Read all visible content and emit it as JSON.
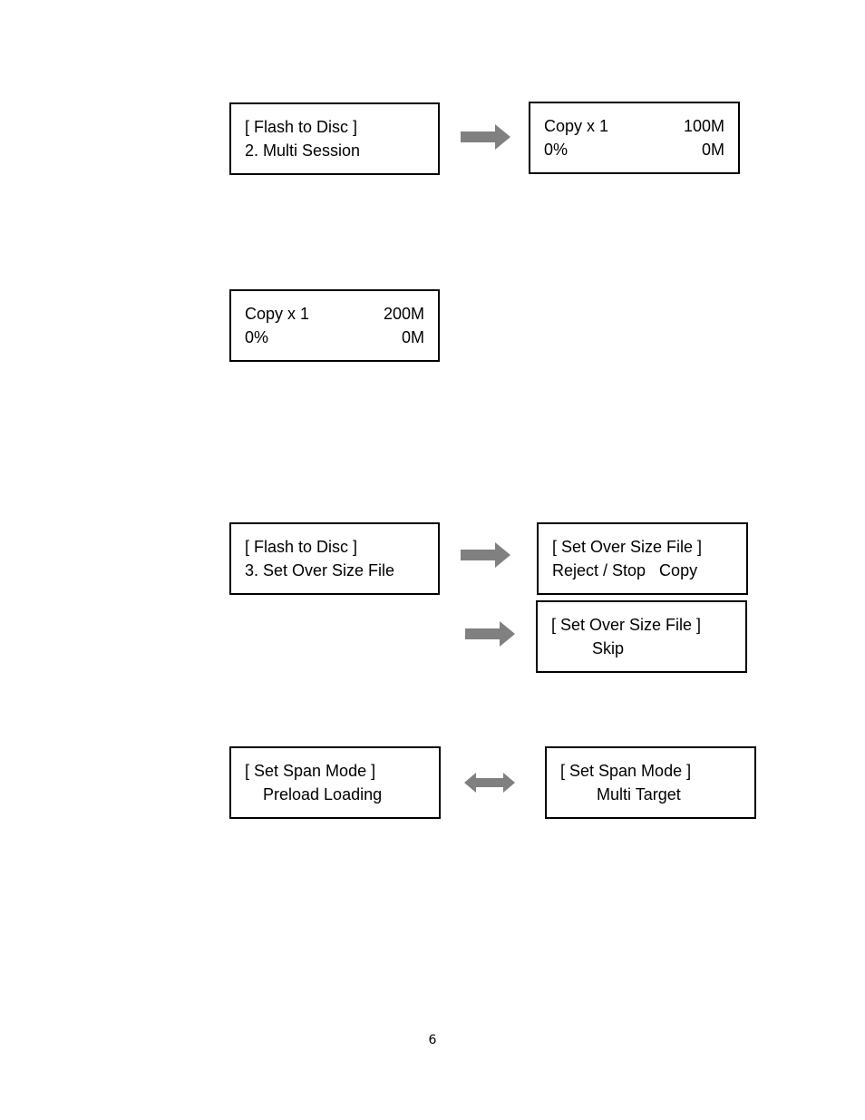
{
  "diagrams": {
    "multi_session": {
      "menu_screen": {
        "line1": "[ Flash to Disc ]",
        "line2": "2. Multi Session"
      },
      "result_screen": {
        "line1_left": "Copy x 1",
        "line1_right": "100M",
        "line2_left": "0%",
        "line2_right": "0M"
      }
    },
    "copy_200m": {
      "screen": {
        "line1_left": "Copy x 1",
        "line1_right": "200M",
        "line2_left": "0%",
        "line2_right": "0M"
      }
    },
    "over_size_file": {
      "menu_screen": {
        "line1": "[ Flash to Disc ]",
        "line2": "3. Set Over Size File"
      },
      "option_screen_1": {
        "line1": "[ Set Over Size File ]",
        "line2": "Reject / Stop   Copy"
      },
      "option_screen_2": {
        "line1": "[ Set Over Size File ]",
        "line2": "         Skip"
      }
    },
    "span_mode": {
      "screen_left": {
        "line1": "[ Set Span Mode ]",
        "line2": "    Preload Loading"
      },
      "screen_right": {
        "line1": "[ Set Span Mode ]",
        "line2": "        Multi Target"
      }
    }
  },
  "icons": {
    "arrow_right": "arrow-right-icon",
    "arrow_double": "double-arrow-icon"
  },
  "colors": {
    "arrow": "#808080",
    "border": "#000000"
  },
  "page_number": "6"
}
